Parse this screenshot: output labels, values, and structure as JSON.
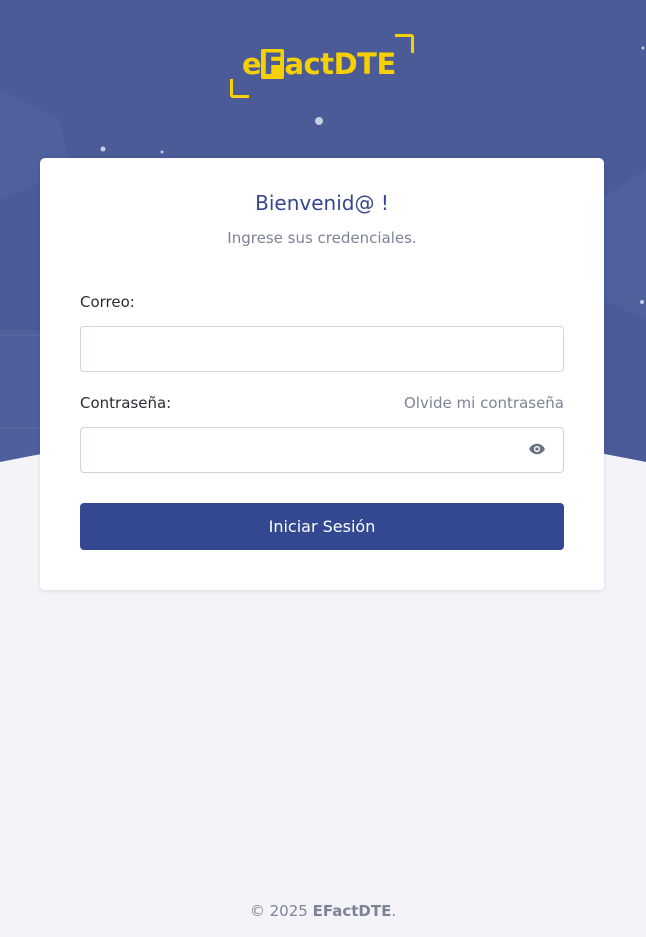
{
  "brand": {
    "logo_prefix": "e",
    "logo_boxed": "F",
    "logo_suffix": "actDTE",
    "accent_color": "#f6d000",
    "hero_color": "#4a5b98",
    "primary_color": "#344892"
  },
  "login": {
    "title": "Bienvenid@ !",
    "subtitle": "Ingrese sus credenciales.",
    "email_label": "Correo:",
    "email_value": "",
    "password_label": "Contraseña:",
    "password_value": "",
    "forgot_link": "Olvide mi contraseña",
    "toggle_icon": "eye-icon",
    "submit_label": "Iniciar Sesión"
  },
  "footer": {
    "copyright": "© 2025",
    "brand": "EFactDTE",
    "end": "."
  }
}
